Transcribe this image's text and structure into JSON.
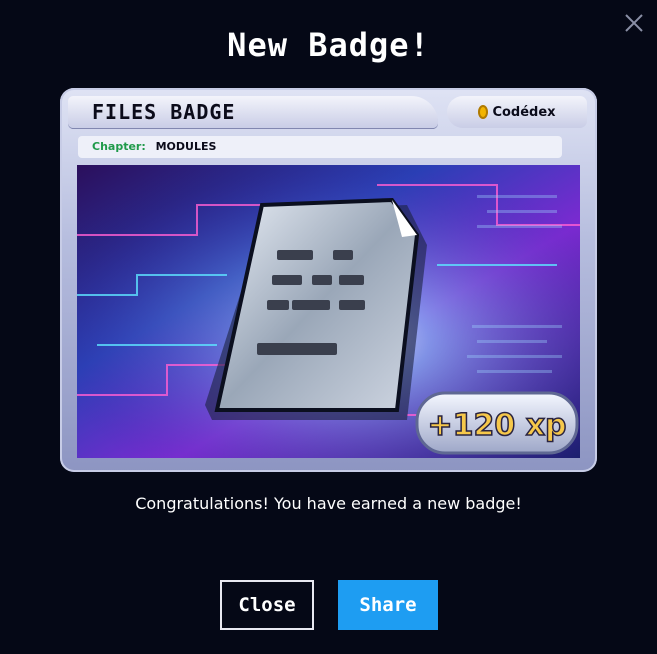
{
  "dialog": {
    "title": "New Badge!",
    "message": "Congratulations! You have earned a new badge!"
  },
  "badge_card": {
    "name": "FILES BADGE",
    "brand": "Codédex",
    "chapter_label": "Chapter:",
    "chapter_value": "MODULES",
    "xp": "+120 xp"
  },
  "buttons": {
    "close": "Close",
    "share": "Share"
  },
  "icons": {
    "dismiss": "close-icon",
    "brand_logo": "coin-icon",
    "badge_art": "document-icon"
  }
}
